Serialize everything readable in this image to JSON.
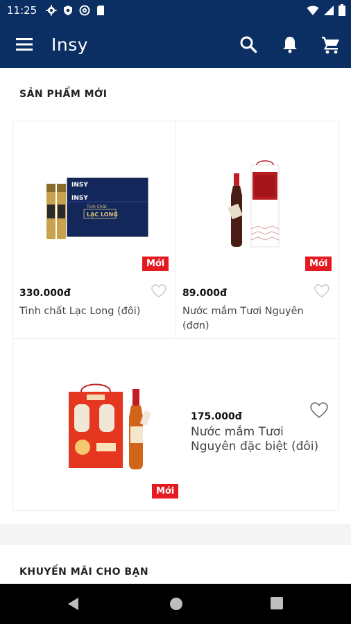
{
  "status_bar": {
    "time": "11:25",
    "left_icons": [
      "settings-icon",
      "shield-icon",
      "at-sign-icon",
      "sd-card-icon"
    ],
    "right_icons": [
      "wifi-icon",
      "signal-icon",
      "battery-icon"
    ]
  },
  "app_bar": {
    "title": "Insy",
    "menu_icon": "hamburger-menu-icon",
    "actions": [
      "search-icon",
      "bell-icon",
      "cart-icon"
    ]
  },
  "sections": {
    "new_products_title": "SẢN PHẨM MỚI",
    "promotions_title": "KHUYẾN MÃI CHO BẠN"
  },
  "products": [
    {
      "price": "330.000đ",
      "name": "Tinh chất Lạc Long (đôi)",
      "badge": "Mới"
    },
    {
      "price": "89.000đ",
      "name": "Nước mắm Tươi Nguyên (đơn)",
      "badge": "Mới"
    },
    {
      "price": "175.000đ",
      "name": "Nước mắm Tươi Nguyên đặc biệt (đôi)",
      "badge": "Mới"
    }
  ],
  "product_box_text": {
    "brand": "INSY",
    "sub": "Tinh Chất",
    "title": "LẠC LONG"
  },
  "colors": {
    "primary": "#0c2f63",
    "badge": "#e51a20",
    "background": "#ffffff"
  },
  "nav_bar": [
    "back-icon",
    "home-icon",
    "recents-icon"
  ]
}
